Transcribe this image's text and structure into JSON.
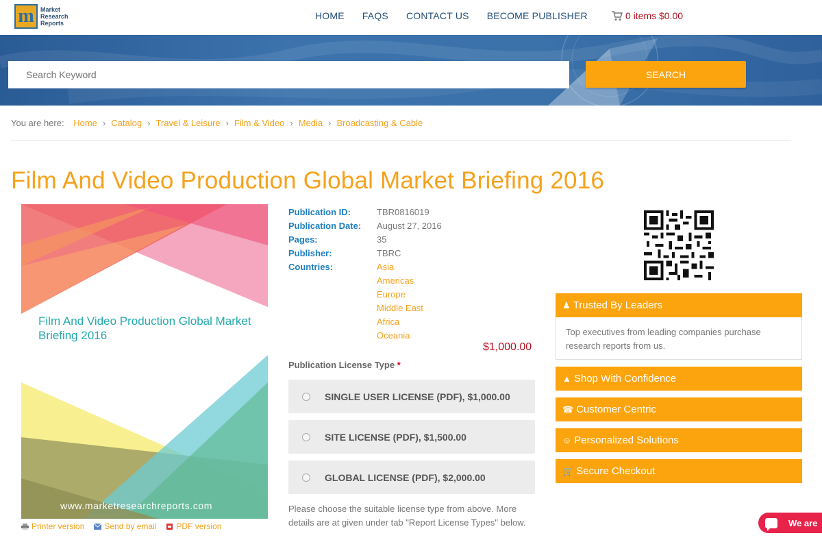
{
  "header": {
    "logo_text": "Market Research Reports",
    "logo_letter": "m",
    "nav": [
      "HOME",
      "FAQS",
      "CONTACT US",
      "BECOME PUBLISHER"
    ],
    "cart": "0 items $0.00"
  },
  "search": {
    "placeholder": "Search Keyword",
    "button": "SEARCH"
  },
  "breadcrumb": {
    "prefix": "You are here:",
    "items": [
      "Home",
      "Catalog",
      "Travel & Leisure",
      "Film & Video",
      "Media",
      "Broadcasting & Cable"
    ]
  },
  "title": "Film And Video Production Global Market Briefing 2016",
  "cover": {
    "title": "Film And Video Production Global Market Briefing 2016",
    "url": "www.marketresearchreports.com"
  },
  "cover_actions": [
    "Printer version",
    "Send by email",
    "PDF version"
  ],
  "details": {
    "publication_id_label": "Publication ID:",
    "publication_id": "TBR0816019",
    "publication_date_label": "Publication Date:",
    "publication_date": "August 27, 2016",
    "pages_label": "Pages:",
    "pages": "35",
    "publisher_label": "Publisher:",
    "publisher": "TBRC",
    "countries_label": "Countries:",
    "countries": [
      "Asia",
      "Americas",
      "Europe",
      "Middle East",
      "Africa",
      "Oceania"
    ]
  },
  "price": "$1,000.00",
  "license": {
    "title": "Publication License Type",
    "required_mark": "*",
    "options": [
      "SINGLE USER LICENSE (PDF), $1,000.00",
      "SITE LICENSE (PDF), $1,500.00",
      "GLOBAL LICENSE (PDF), $2,000.00"
    ],
    "note": "Please choose the suitable license type from above. More details are at given under tab \"Report License Types\" below."
  },
  "sidebar": {
    "trusted_title": "Trusted By Leaders",
    "trusted_body": "Top executives from leading companies purchase research reports from us.",
    "boxes": [
      "Shop With Confidence",
      "Customer Centric",
      "Personalized Solutions",
      "Secure Checkout"
    ]
  },
  "chat": {
    "label": "We are"
  },
  "colors": {
    "accent": "#fca40e",
    "link": "#f3a11b",
    "blue": "#1f7fc0",
    "price": "#b4121f",
    "chat": "#e8234a"
  }
}
